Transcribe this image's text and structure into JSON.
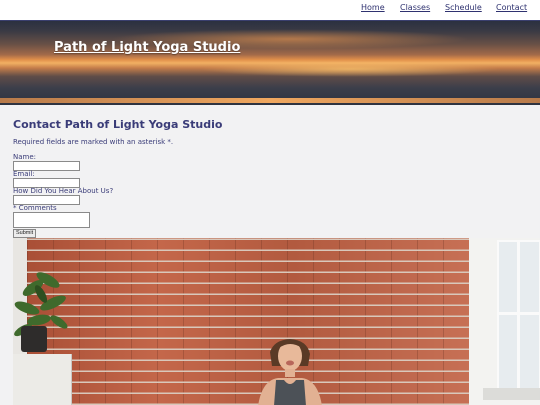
{
  "nav": {
    "items": [
      {
        "label": "Home"
      },
      {
        "label": "Classes"
      },
      {
        "label": "Schedule"
      },
      {
        "label": "Contact"
      }
    ]
  },
  "hero": {
    "site_title": "Path of Light Yoga Studio"
  },
  "contact_form": {
    "heading": "Contact Path of Light Yoga Studio",
    "required_note": "Required fields are marked with an asterisk *.",
    "fields": [
      {
        "label": "Name:",
        "value": ""
      },
      {
        "label": "Email:",
        "value": ""
      },
      {
        "label": "How Did You Hear About Us?",
        "value": ""
      },
      {
        "label": "* Comments",
        "value": ""
      }
    ],
    "submit_label": "Submit"
  },
  "colors": {
    "text": "#3b3d7a",
    "page_bg": "#f2f2f3",
    "nav_bg": "#ffffff"
  },
  "icons": {
    "photo": "yoga-instructor-photo"
  }
}
